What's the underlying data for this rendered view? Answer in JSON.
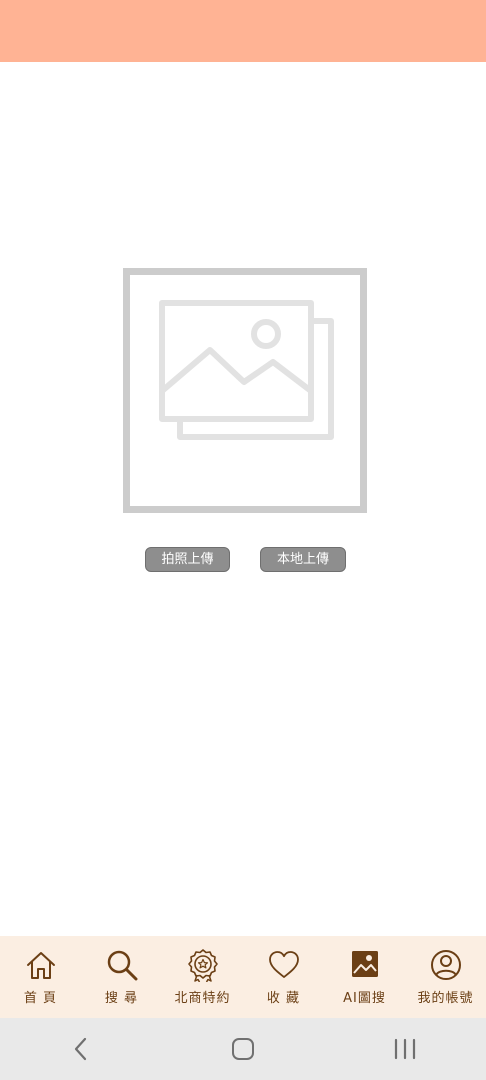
{
  "buttons": {
    "camera_upload": "拍照上傳",
    "local_upload": "本地上傳"
  },
  "nav": {
    "items": [
      {
        "label": "首 頁",
        "icon": "home-icon"
      },
      {
        "label": "搜 尋",
        "icon": "search-icon"
      },
      {
        "label": "北商特約",
        "icon": "badge-star-icon"
      },
      {
        "label": "收 藏",
        "icon": "heart-icon"
      },
      {
        "label": "AI圖搜",
        "icon": "image-search-icon"
      },
      {
        "label": "我的帳號",
        "icon": "account-icon"
      }
    ]
  },
  "system_nav": {
    "icons": [
      "back-icon",
      "home-button-icon",
      "recents-icon"
    ]
  },
  "colors": {
    "top_bar": "#ffb394",
    "bottom_nav_bg": "#fbeee2",
    "nav_accent": "#6b3f15",
    "upload_button": "#8e8e8e",
    "placeholder_gray": "#cccccc"
  }
}
